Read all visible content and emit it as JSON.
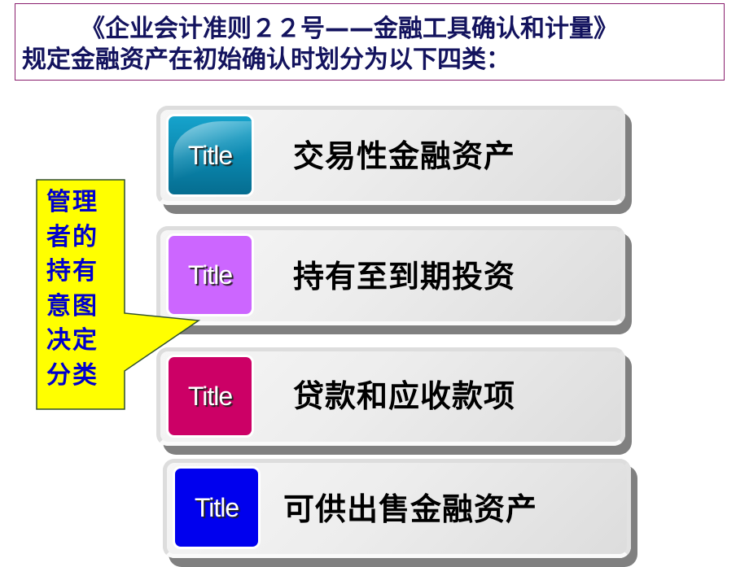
{
  "header": {
    "line1": "《企业会计准则２２号——金融工具确认和计量》",
    "line2": "规定金融资产在初始确认时划分为以下四类："
  },
  "callout": {
    "text": "管理者的持有意图决定分类",
    "background": "#ffff00",
    "text_color": "#0000cc"
  },
  "categories": [
    {
      "badge": "Title",
      "label": "交易性金融资产",
      "color": "#0a86ad"
    },
    {
      "badge": "Title",
      "label": "持有至到期投资",
      "color": "#cc66ff"
    },
    {
      "badge": "Title",
      "label": "贷款和应收款项",
      "color": "#cc0066"
    },
    {
      "badge": "Title",
      "label": "可供出售金融资产",
      "color": "#0000ee"
    }
  ]
}
